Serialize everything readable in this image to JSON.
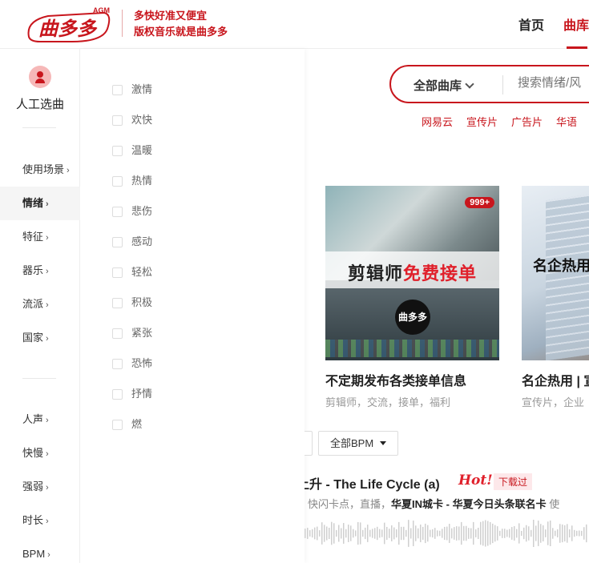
{
  "brand": {
    "logo_text": "曲多多",
    "logo_sup": "AGM",
    "slogan_line1": "多快好准又便宜",
    "slogan_line2": "版权音乐就是曲多多",
    "accent_color": "#c8161d"
  },
  "nav": {
    "items": [
      "首页",
      "曲库"
    ],
    "active": "曲库"
  },
  "sidebar": {
    "ai_pick_label": "人工选曲",
    "groups1": [
      "使用场景",
      "情绪",
      "特征",
      "器乐",
      "流派",
      "国家"
    ],
    "groups2": [
      "人声",
      "快慢",
      "强弱",
      "时长",
      "BPM"
    ],
    "active": "情绪",
    "arrow": "›"
  },
  "mood_panel": {
    "options": [
      "激情",
      "欢快",
      "温暖",
      "热情",
      "悲伤",
      "感动",
      "轻松",
      "积极",
      "紧张",
      "恐怖",
      "抒情",
      "燃"
    ]
  },
  "search": {
    "category": "全部曲库",
    "placeholder": "搜索情绪/风"
  },
  "hot_tags": [
    "网易云",
    "宣传片",
    "广告片",
    "华语"
  ],
  "cards": [
    {
      "title": "不定期发布各类接单信息",
      "tags": "剪辑师，交流，接单，福利",
      "badge": "999+",
      "banner_a": "剪辑师",
      "banner_b": "免费接单",
      "round_logo": "曲多多"
    },
    {
      "title": "名企热用 | 宣",
      "tags": "宣传片，企业",
      "banner": "名企热用"
    }
  ],
  "filters": {
    "bpm_label": "全部BPM"
  },
  "song": {
    "title": "上升 - The Life Cycle (a)",
    "hot_mark": "Hot!",
    "download_tag": "下载过",
    "meta_prefix": "快闪卡点，直播，",
    "meta_bold": "华夏IN城卡 - 华夏今日头条联名卡",
    "meta_suffix": "使"
  }
}
